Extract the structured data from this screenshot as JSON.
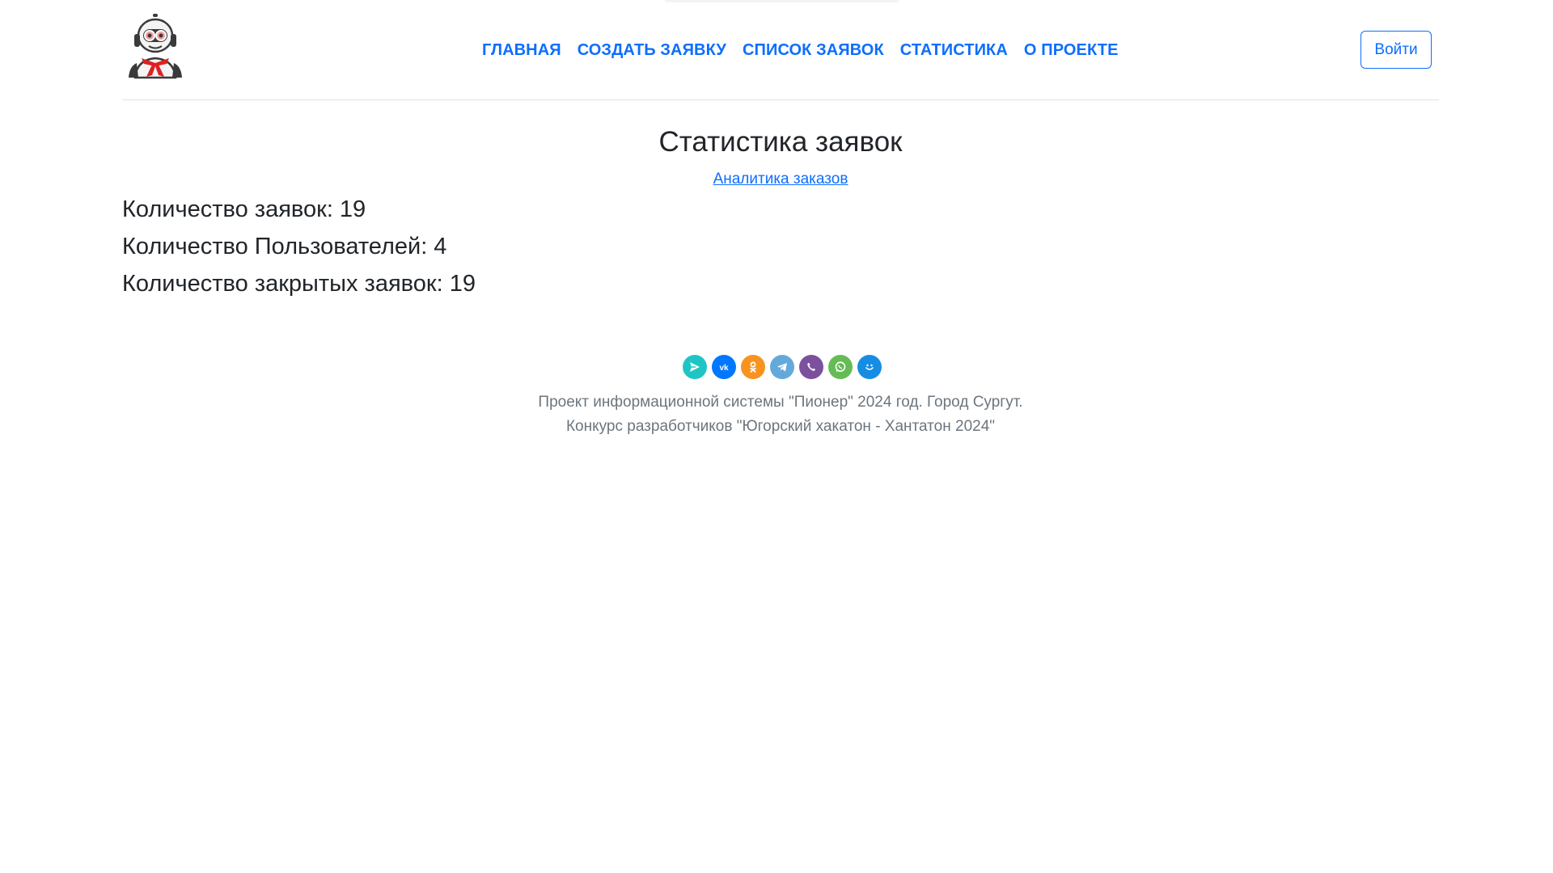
{
  "header": {
    "logo_alt": "robot-pioneer-logo",
    "nav": [
      {
        "label": "ГЛАВНАЯ"
      },
      {
        "label": "СОЗДАТЬ ЗАЯВКУ"
      },
      {
        "label": "СПИСОК ЗАЯВОК"
      },
      {
        "label": "СТАТИСТИКА"
      },
      {
        "label": "О ПРОЕКТЕ"
      }
    ],
    "login_label": "Войти"
  },
  "main": {
    "title": "Статистика заявок",
    "analytics_link": "Аналитика заказов",
    "stats": [
      {
        "label": "Количество заявок: 19"
      },
      {
        "label": "Количество Пользователей: 4"
      },
      {
        "label": "Количество закрытых заявок: 19"
      }
    ]
  },
  "footer": {
    "share_icons": [
      {
        "name": "share-icon",
        "color": "#1ec5c5"
      },
      {
        "name": "vk-icon",
        "color": "#0077ff"
      },
      {
        "name": "odnoklassniki-icon",
        "color": "#f7931e"
      },
      {
        "name": "telegram-icon",
        "color": "#64a9dc"
      },
      {
        "name": "viber-icon",
        "color": "#7b519d"
      },
      {
        "name": "whatsapp-icon",
        "color": "#65bc54"
      },
      {
        "name": "moimir-icon",
        "color": "#168de2"
      }
    ],
    "line1": "Проект информационной системы \"Пионер\" 2024 год. Город Сургут.",
    "line2": "Конкурс разработчиков \"Югорский хакатон - Хантатон 2024\""
  },
  "colors": {
    "accent": "#0d6efd",
    "text": "#212529",
    "muted": "#6c757d",
    "divider": "#dee2e6"
  }
}
